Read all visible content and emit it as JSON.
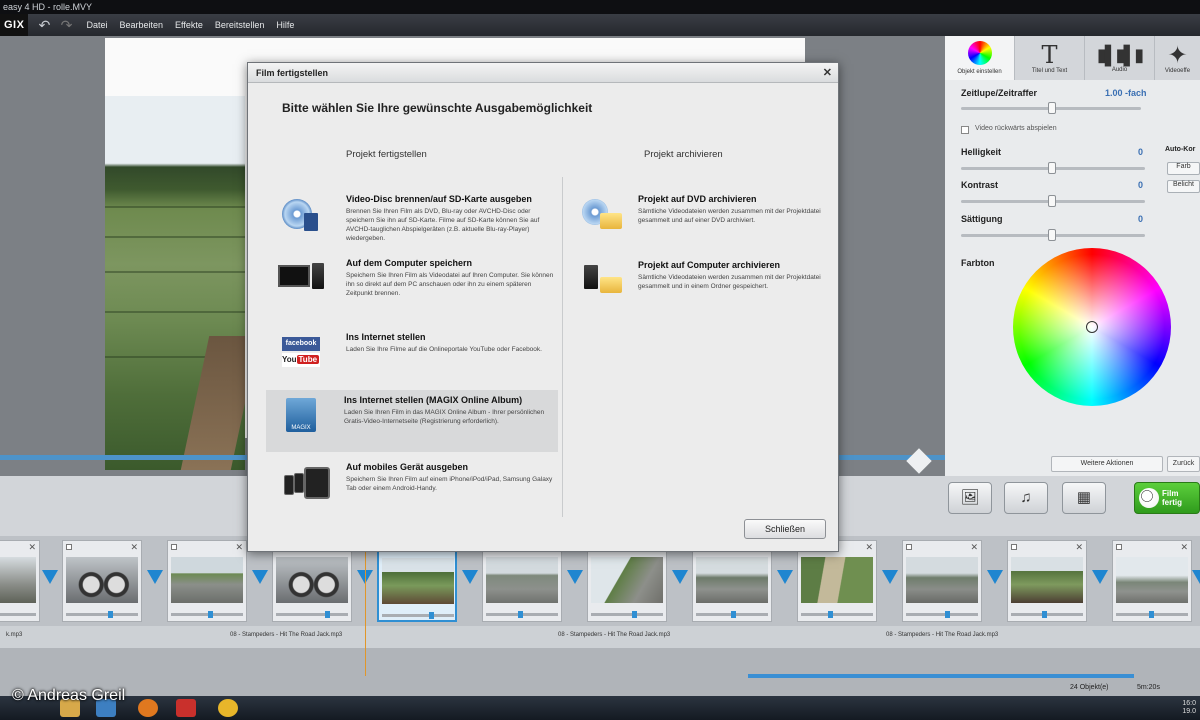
{
  "window": {
    "title": "easy 4 HD - rolle.MVY"
  },
  "app": {
    "logo": "GIX"
  },
  "menu": [
    "Datei",
    "Bearbeiten",
    "Effekte",
    "Bereitstellen",
    "Hilfe"
  ],
  "dialog": {
    "title": "Film fertigstellen",
    "heading": "Bitte wählen Sie Ihre gewünschte Ausgabemöglichkeit",
    "left_column": "Projekt fertigstellen",
    "right_column": "Projekt archivieren",
    "options_left": [
      {
        "title": "Video-Disc brennen/auf SD-Karte ausgeben",
        "desc": "Brennen Sie Ihren Film als DVD, Blu-ray oder AVCHD-Disc oder speichern Sie ihn auf SD-Karte. Filme auf SD-Karte können Sie auf AVCHD-tauglichen Abspielgeräten (z.B. aktuelle Blu-ray-Player) wiedergeben."
      },
      {
        "title": "Auf dem Computer speichern",
        "desc": "Speichern Sie Ihren Film als Videodatei auf Ihren Computer. Sie können ihn so direkt auf dem PC anschauen oder ihn zu einem späteren Zeitpunkt brennen."
      },
      {
        "title": "Ins Internet stellen",
        "desc": "Laden Sie Ihre Filme auf die Onlineportale YouTube oder Facebook."
      },
      {
        "title": "Ins Internet stellen (MAGIX Online Album)",
        "desc": "Laden Sie Ihren Film in das MAGIX Online Album - Ihrer persönlichen Gratis-Video-Internetseite (Registrierung erforderlich)."
      },
      {
        "title": "Auf mobiles Gerät ausgeben",
        "desc": "Speichern Sie Ihren Film auf einem iPhone/iPod/iPad, Samsung Galaxy Tab oder einem Android-Handy."
      }
    ],
    "options_right": [
      {
        "title": "Projekt auf DVD archivieren",
        "desc": "Sämtliche Videodateien werden zusammen mit der Projektdatei gesammelt und auf einer DVD archiviert."
      },
      {
        "title": "Projekt auf Computer archivieren",
        "desc": "Sämtliche Videodateien werden zusammen mit der Projektdatei gesammelt und in einem Ordner gespeichert."
      }
    ],
    "icon_labels": {
      "facebook": "facebook",
      "you": "You",
      "tube": "Tube",
      "magix": "MAGIX"
    },
    "close_label": "Schließen"
  },
  "right_panel": {
    "tabs": [
      "Objekt einstellen",
      "Titel und Text",
      "Audio",
      "Videoeffe"
    ],
    "speed_label": "Zeitlupe/Zeitraffer",
    "speed_value": "1.00 -fach",
    "reverse_label": "Video rückwärts abspielen",
    "brightness_label": "Helligkeit",
    "brightness_value": "0",
    "contrast_label": "Kontrast",
    "contrast_value": "0",
    "saturation_label": "Sättigung",
    "saturation_value": "0",
    "auto_label": "Auto-Kor",
    "auto_btn1": "Farb",
    "auto_btn2": "Belicht",
    "hue_label": "Farbton",
    "more_actions": "Weitere Aktionen",
    "back": "Zurück"
  },
  "toolbar": {
    "finish_label": "Film fertig"
  },
  "audio_tracks": [
    "k.mp3",
    "08 - Stampeders - Hit The Road Jack.mp3",
    "08 - Stampeders - Hit The Road Jack.mp3",
    "08 - Stampeders - Hit The Road Jack.mp3"
  ],
  "status": {
    "objects": "24 Objekt(e)",
    "duration": "5m:20s"
  },
  "copyright": "© Andreas Greil",
  "clock": {
    "time": "16:0",
    "line": "19.0"
  },
  "colors": {
    "accent_blue": "#2f8fd3",
    "finish_green": "#3fb52a"
  }
}
